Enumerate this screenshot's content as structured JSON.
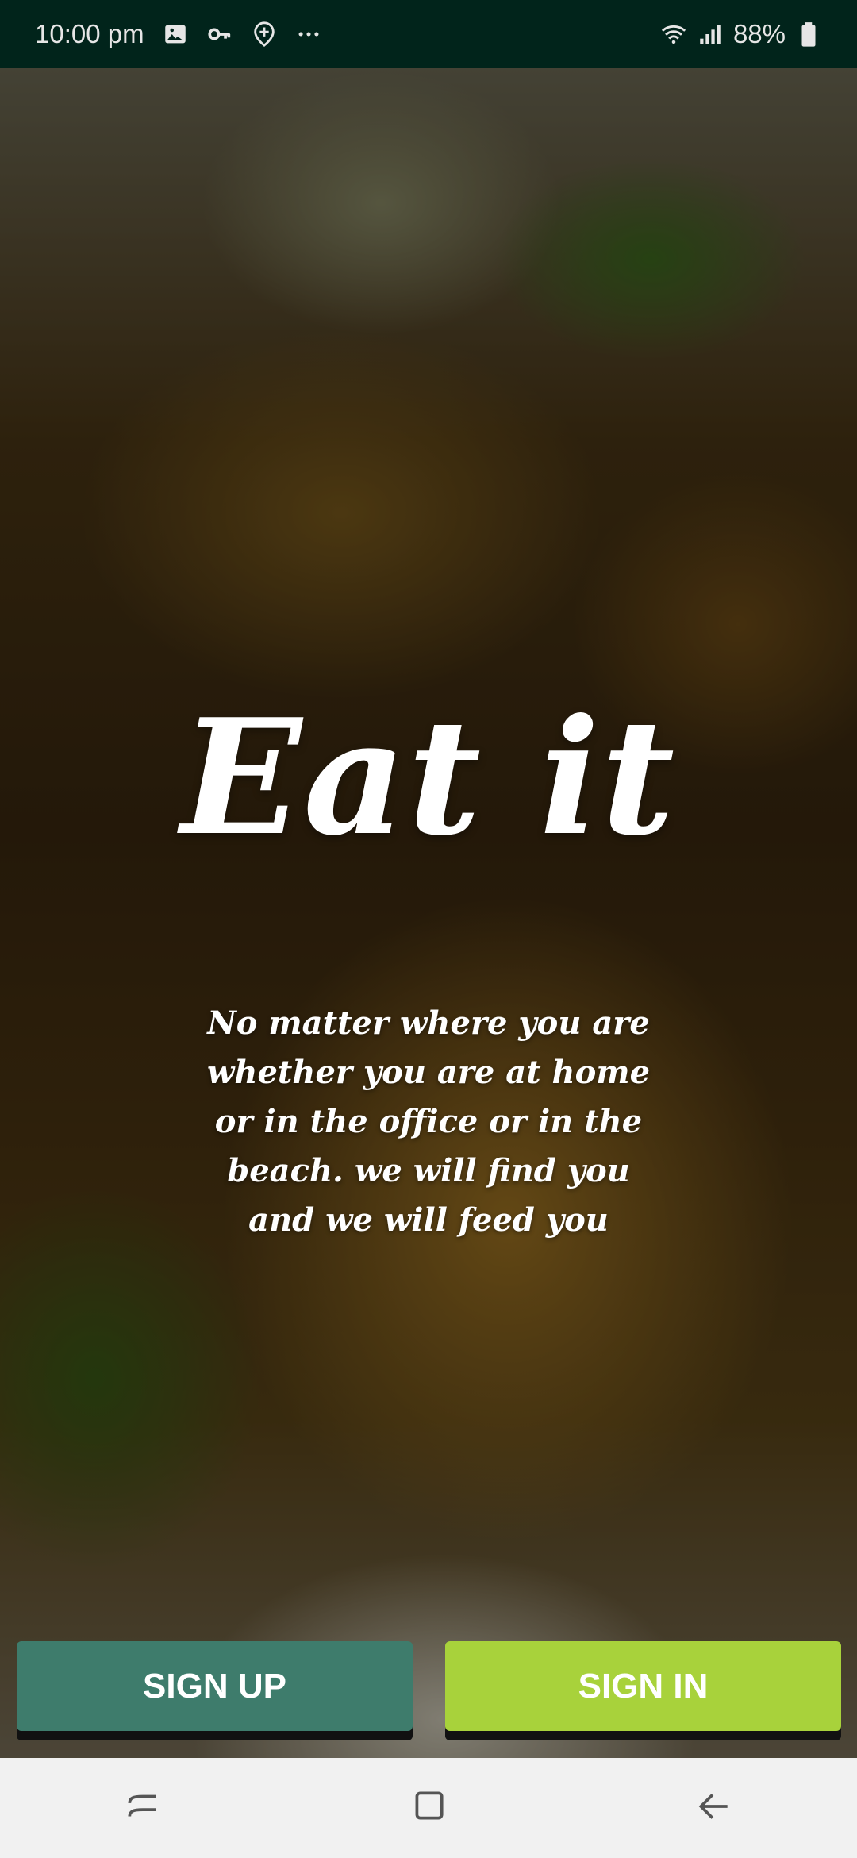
{
  "status_bar": {
    "time": "10:00 pm",
    "left_icons": [
      "image-icon",
      "key-icon",
      "location-plus-icon",
      "more-dots-icon"
    ],
    "right_icons": [
      "wifi-icon",
      "signal-icon"
    ],
    "battery": "88%"
  },
  "hero": {
    "brand": "Eat it",
    "tagline": "No matter where you are whether you are at home or in the office or in the beach. we will find you and we will feed you"
  },
  "buttons": {
    "sign_up": "SIGN UP",
    "sign_in": "SIGN IN"
  },
  "colors": {
    "status_bar_bg": "#01241b",
    "sign_up_bg": "#3e7c6c",
    "sign_in_bg": "#a8d23b",
    "nav_bar_bg": "#f1f1f1"
  },
  "nav_bar": {
    "icons": [
      "recents-icon",
      "home-icon",
      "back-icon"
    ]
  }
}
